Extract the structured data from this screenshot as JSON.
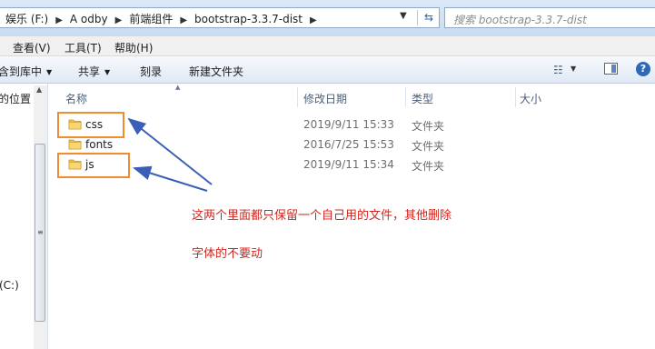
{
  "address_bar": {
    "breadcrumbs": [
      "娱乐 (F:)",
      "A odby",
      "前端组件",
      "bootstrap-3.3.7-dist"
    ],
    "search_placeholder": "搜索 bootstrap-3.3.7-dist"
  },
  "menu": [
    "查看(V)",
    "工具(T)",
    "帮助(H)"
  ],
  "command_bar": {
    "include_in_library": "含到库中",
    "share": "共享",
    "burn": "刻录",
    "new_folder": "新建文件夹"
  },
  "nav": {
    "location": "的位置",
    "drive": "(C:)"
  },
  "columns": {
    "name": "名称",
    "date_modified": "修改日期",
    "type": "类型",
    "size": "大小"
  },
  "files": [
    {
      "name": "css",
      "date": "2019/9/11 15:33",
      "type": "文件夹"
    },
    {
      "name": "fonts",
      "date": "2016/7/25 15:53",
      "type": "文件夹"
    },
    {
      "name": "js",
      "date": "2019/9/11 15:34",
      "type": "文件夹"
    }
  ],
  "annotation": {
    "line1": "这两个里面都只保留一个自己用的文件，其他删除",
    "line2": "字体的不要动"
  },
  "colors": {
    "highlight_box": "#f08c2e",
    "annotation_text": "#d4241c",
    "arrow": "#3b5fb6"
  }
}
